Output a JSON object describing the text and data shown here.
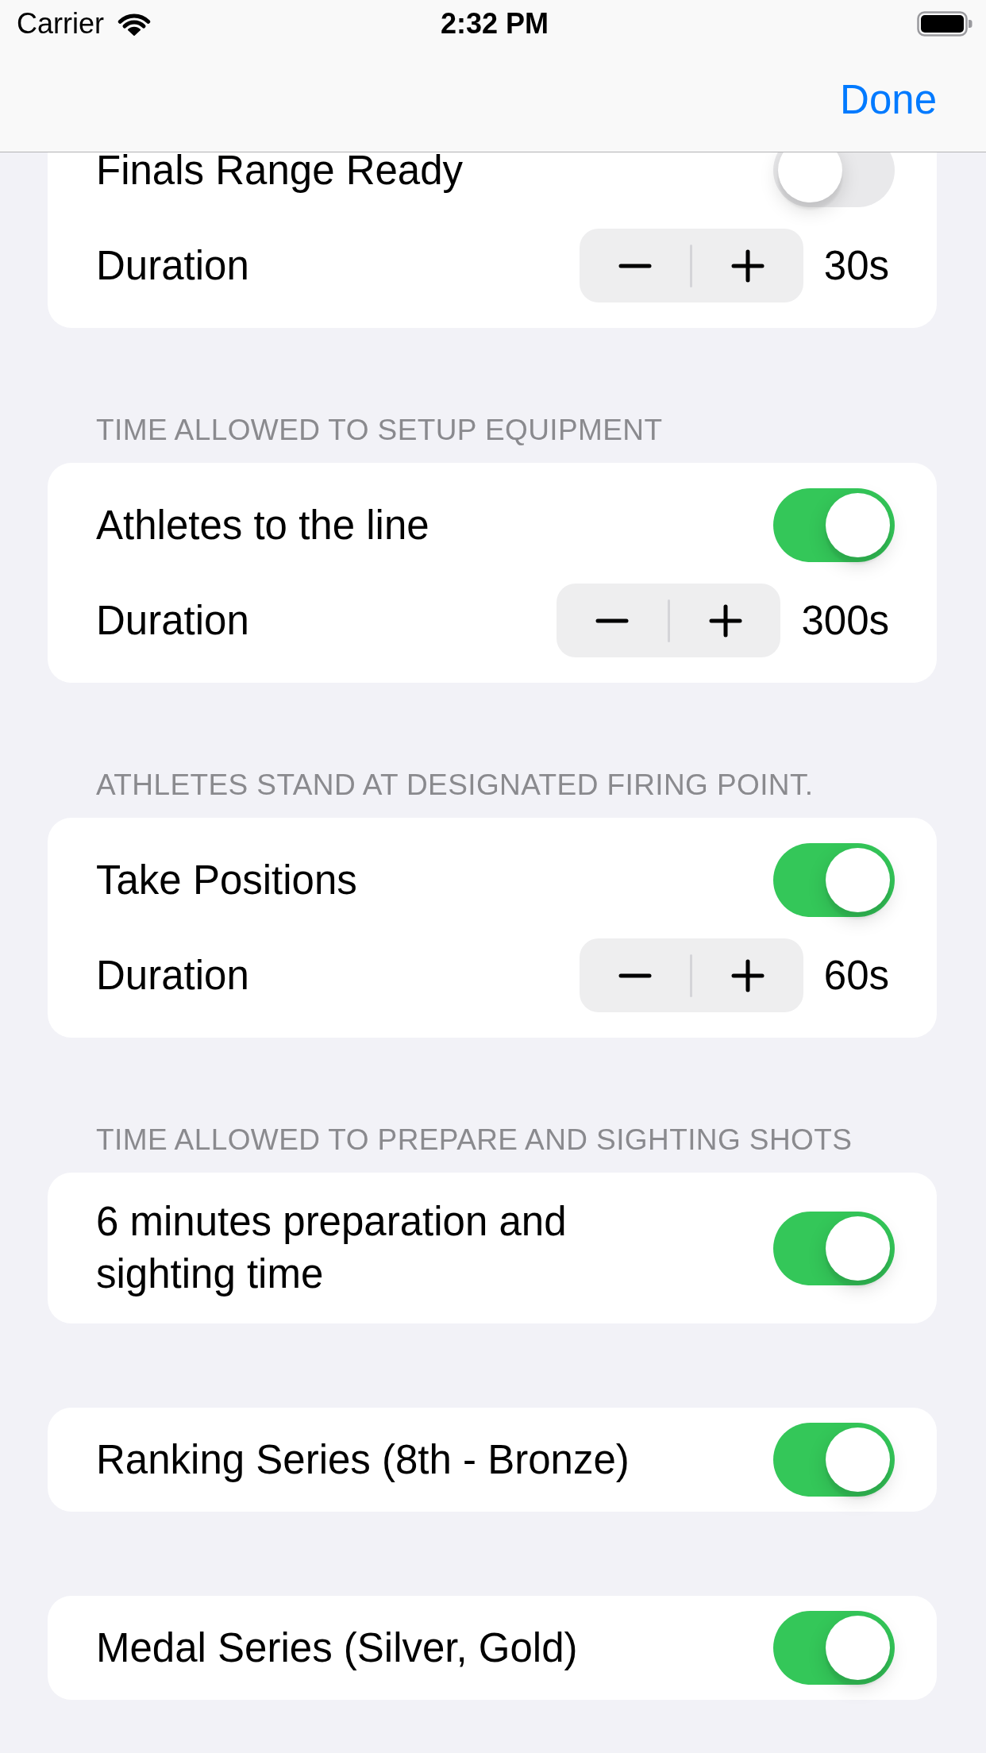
{
  "status_bar": {
    "carrier": "Carrier",
    "time": "2:32 PM"
  },
  "nav_bar": {
    "done_button": "Done"
  },
  "sections": [
    {
      "rows": [
        {
          "kind": "toggle",
          "label": "Finals Range Ready",
          "on": false
        },
        {
          "kind": "stepper",
          "label": "Duration",
          "value": "30s"
        }
      ]
    },
    {
      "header": "TIME ALLOWED TO SETUP EQUIPMENT",
      "rows": [
        {
          "kind": "toggle",
          "label": "Athletes to the line",
          "on": true
        },
        {
          "kind": "stepper",
          "label": "Duration",
          "value": "300s"
        }
      ]
    },
    {
      "header": "ATHLETES STAND AT DESIGNATED FIRING POINT.",
      "rows": [
        {
          "kind": "toggle",
          "label": "Take Positions",
          "on": true
        },
        {
          "kind": "stepper",
          "label": "Duration",
          "value": "60s"
        }
      ]
    },
    {
      "header": "TIME ALLOWED TO PREPARE AND SIGHTING SHOTS",
      "rows": [
        {
          "kind": "toggle",
          "label": "6 minutes preparation and sighting time",
          "on": true
        }
      ]
    },
    {
      "rows": [
        {
          "kind": "toggle",
          "label": "Ranking Series (8th - Bronze)",
          "on": true
        }
      ]
    },
    {
      "rows": [
        {
          "kind": "toggle",
          "label": "Medal Series (Silver, Gold)",
          "on": true
        }
      ]
    }
  ]
}
